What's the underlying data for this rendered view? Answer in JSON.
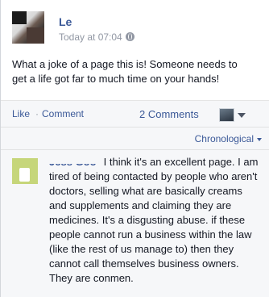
{
  "post": {
    "author": "Le",
    "timestamp": "Today at 07:04",
    "text": "What a joke of a page this is! Someone needs to get a life got far to much time on your hands!"
  },
  "actions": {
    "like": "Like",
    "separator": "·",
    "comment": "Comment",
    "comments_count": "2 Comments"
  },
  "ordering": {
    "label": "Chronological"
  },
  "comment": {
    "author": "Jess Goo",
    "text": "I think it's an excellent page. I am tired of being contacted by people who aren't doctors, selling what are basically creams and supplements and claiming they are medicines. It's a disgusting abuse. if these people cannot run a business within the law (like the rest of us manage to) then they cannot call themselves business owners. They are conmen."
  }
}
